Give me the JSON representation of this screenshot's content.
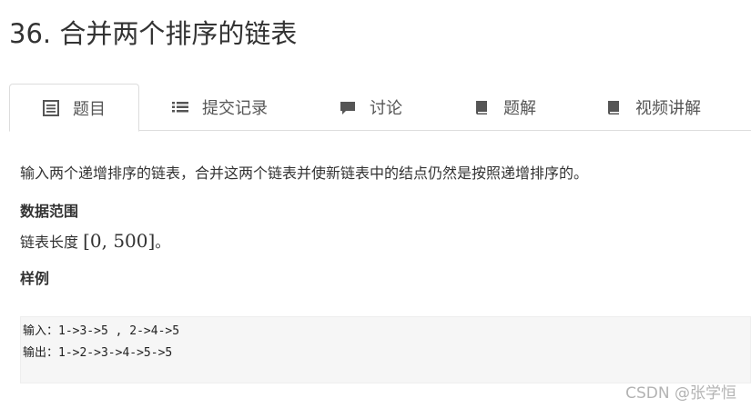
{
  "page": {
    "title": "36. 合并两个排序的链表"
  },
  "tabs": [
    {
      "label": "题目",
      "icon": "document-list-icon",
      "active": true
    },
    {
      "label": "提交记录",
      "icon": "list-icon",
      "active": false
    },
    {
      "label": "讨论",
      "icon": "comment-icon",
      "active": false
    },
    {
      "label": "题解",
      "icon": "book-icon",
      "active": false
    },
    {
      "label": "视频讲解",
      "icon": "book-icon",
      "active": false
    }
  ],
  "problem": {
    "description": "输入两个递增排序的链表，合并这两个链表并使新链表中的结点仍然是按照递增排序的。",
    "range_heading": "数据范围",
    "range_prefix": "链表长度 ",
    "range_value": "[0, 500]",
    "range_suffix": "。",
    "example_heading": "样例",
    "example_lines": [
      "输入：1->3->5 , 2->4->5",
      "",
      "输出：1->2->3->4->5->5"
    ]
  },
  "watermark": "CSDN @张学恒",
  "colors": {
    "text": "#333333",
    "tab_text": "#555555",
    "icon": "#555555",
    "border": "#dddddd",
    "code_bg": "#f6f6f6",
    "watermark": "#b3b3b3"
  }
}
